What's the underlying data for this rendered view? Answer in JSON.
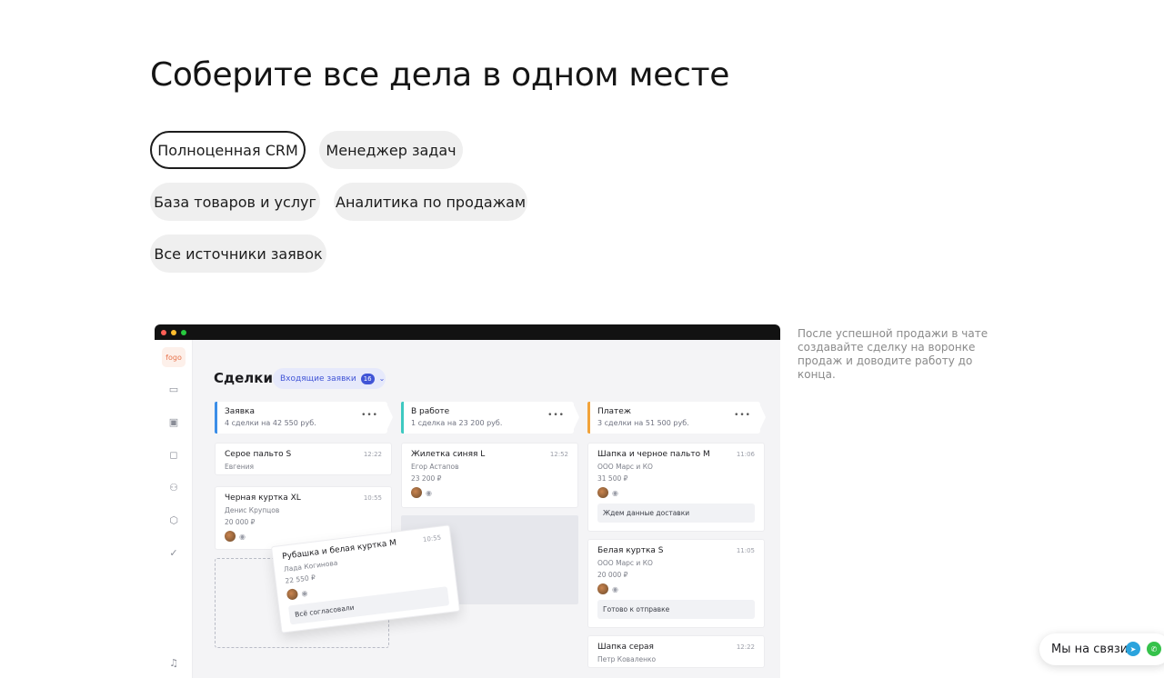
{
  "heading": "Соберите все дела в одном месте",
  "tabs": [
    {
      "label": "Полноценная CRM",
      "active": true
    },
    {
      "label": "Менеджер задач",
      "active": false
    },
    {
      "label": "База товаров и услуг",
      "active": false
    },
    {
      "label": "Аналитика по продажам",
      "active": false
    },
    {
      "label": "Все источники заявок",
      "active": false
    }
  ],
  "description": "После успешной продажи в чате создавайте сделку на воронке продаж и доводите работу до конца.",
  "app": {
    "logo": "fogo",
    "title": "Сделки",
    "incoming_label": "Входящие заявки",
    "incoming_count": "16",
    "columns": [
      {
        "title": "Заявка",
        "summary": "4 сделки на 42 550 руб.",
        "color": "#3b8ee8",
        "cards": [
          {
            "name": "Серое пальто S",
            "time": "12:22",
            "person": "Евгения"
          },
          {
            "name": "Черная куртка XL",
            "time": "10:55",
            "person": "Денис Крупцов",
            "price": "20 000 ₽"
          }
        ]
      },
      {
        "title": "В работе",
        "summary": "1 сделка на 23 200 руб.",
        "color": "#3ec9c1",
        "cards": [
          {
            "name": "Жилетка синяя L",
            "time": "12:52",
            "person": "Егор Астапов",
            "price": "23 200 ₽"
          }
        ]
      },
      {
        "title": "Платеж",
        "summary": "3 сделки на 51 500 руб.",
        "color": "#f2a33a",
        "cards": [
          {
            "name": "Шапка и черное пальто M",
            "time": "11:06",
            "person": "ООО Марс и КО",
            "price": "31 500 ₽",
            "note": "Ждем данные доставки"
          },
          {
            "name": "Белая куртка S",
            "time": "11:05",
            "person": "ООО Марс и КО",
            "price": "20 000 ₽",
            "note": "Готово к отправке"
          },
          {
            "name": "Шапка серая",
            "time": "12:22",
            "person": "Петр Коваленко"
          }
        ]
      }
    ],
    "dragging_card": {
      "name": "Рубашка и белая куртка M",
      "time": "10:55",
      "person": "Лада Когинова",
      "price": "22 550 ₽",
      "note": "Всё согласовали"
    }
  },
  "chat_widget": {
    "label": "Мы на связи"
  },
  "colors": {
    "accent": "#4054d6",
    "dark": "#121212"
  }
}
